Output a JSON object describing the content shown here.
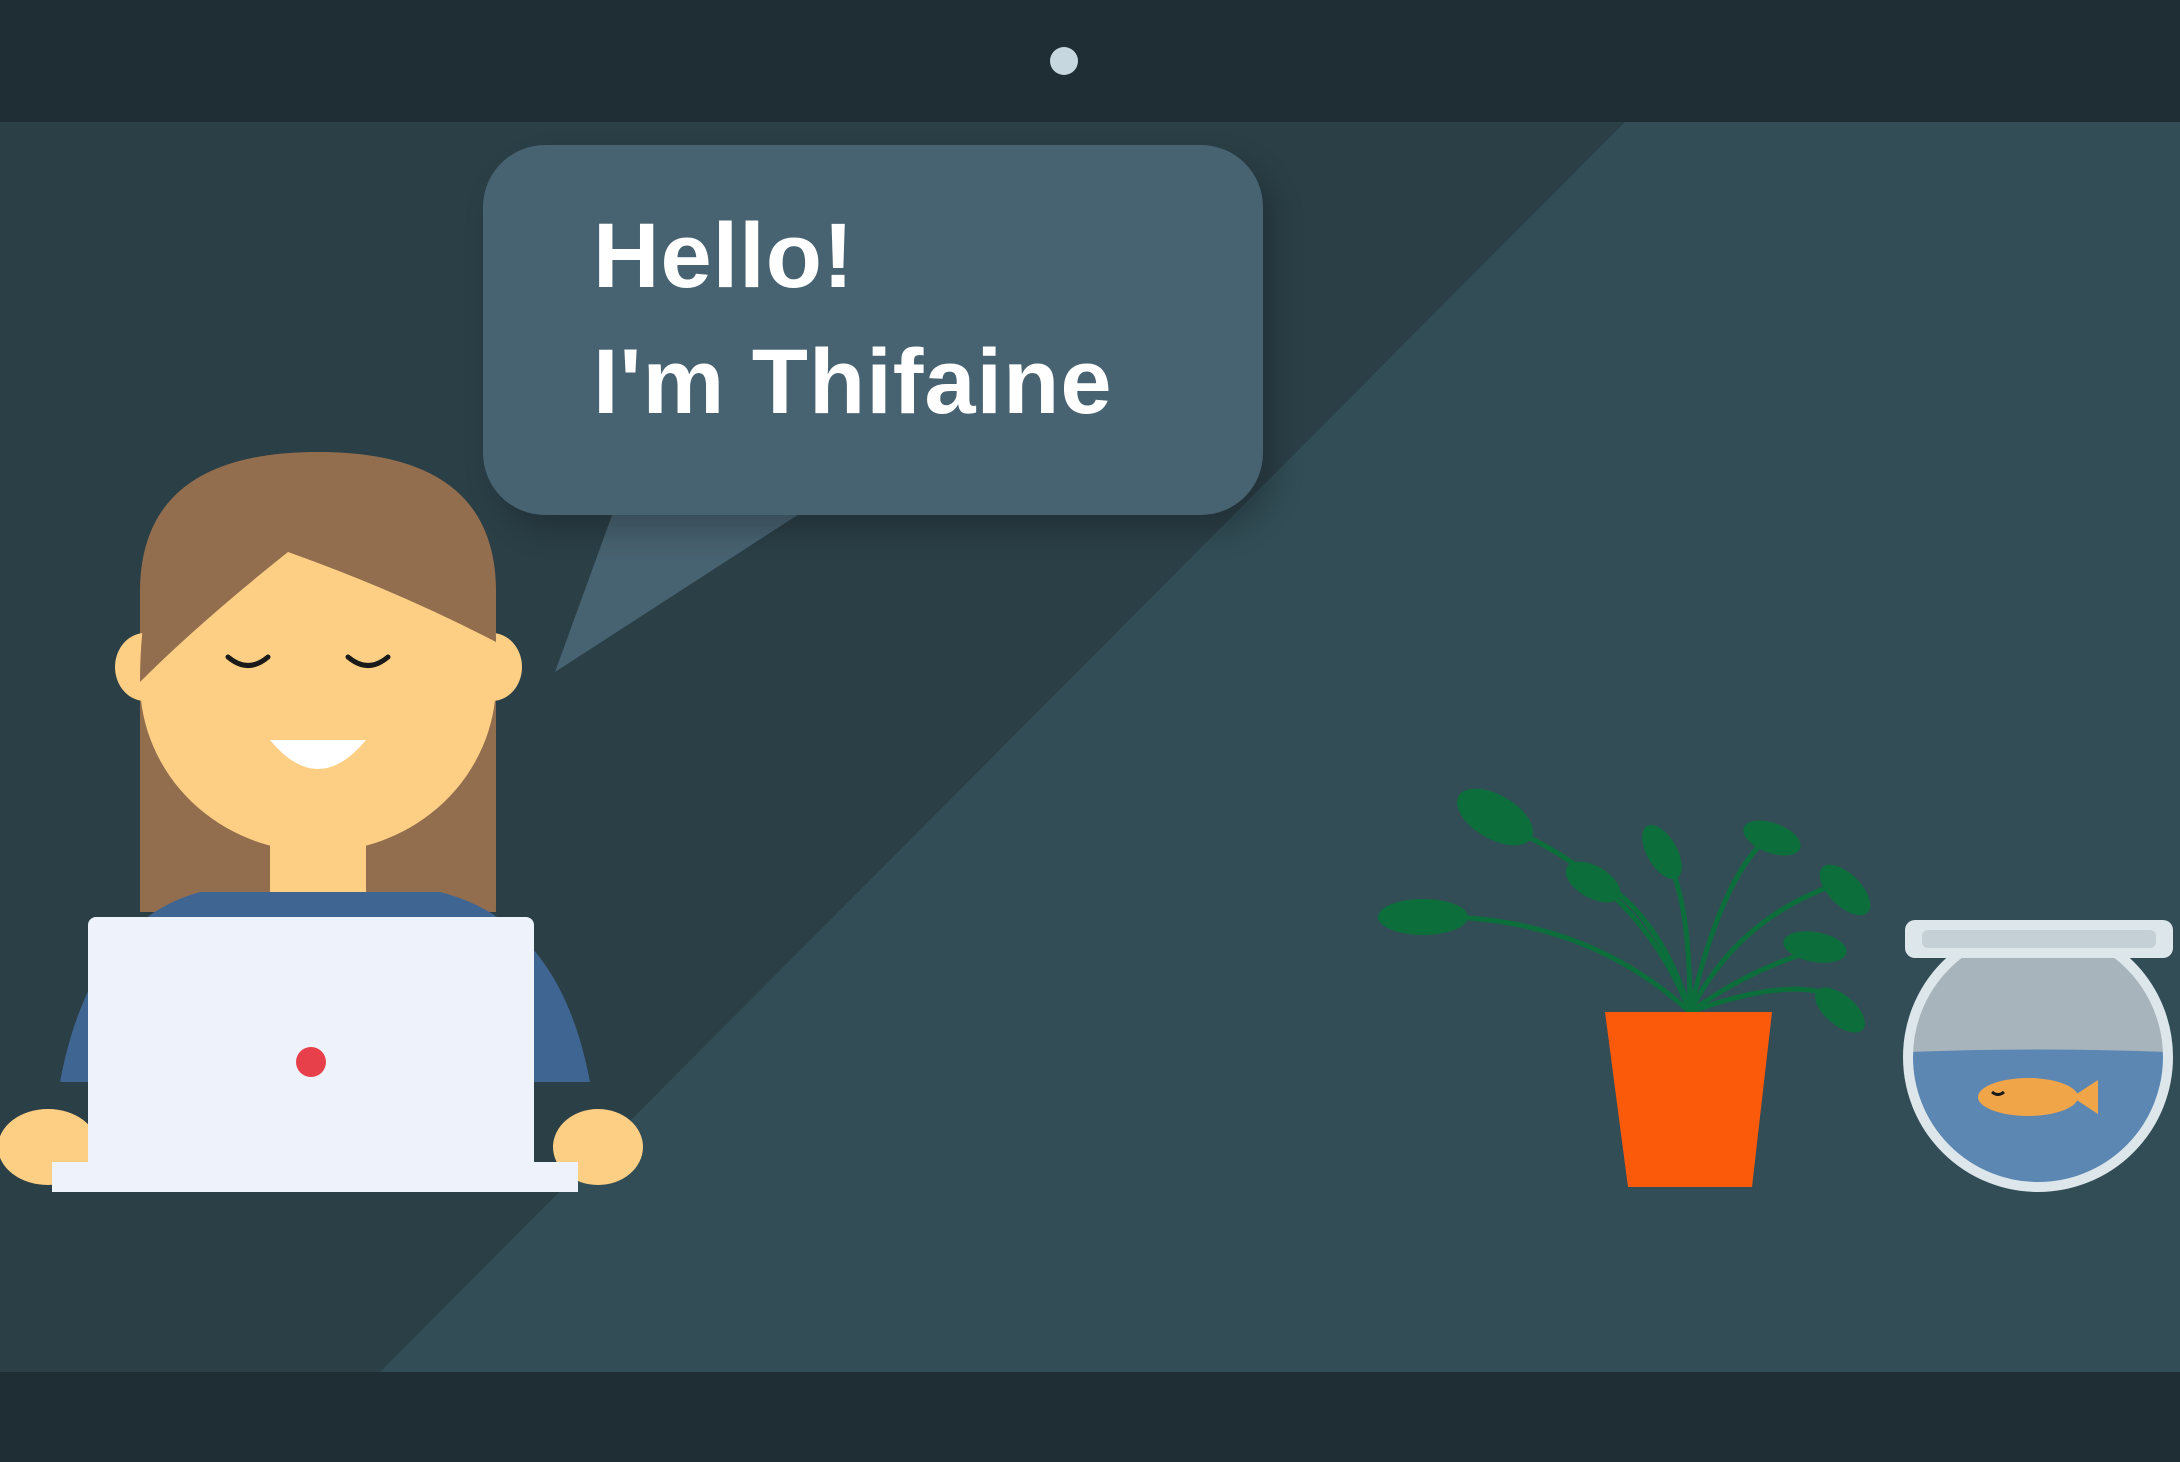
{
  "speech_bubble": {
    "line1": "Hello!",
    "line2": "I'm Thifaine"
  },
  "icons": {
    "webcam": "camera-dot",
    "character": "person-with-laptop",
    "plant": "potted-plant",
    "fishbowl": "fishbowl-with-goldfish"
  },
  "colors": {
    "frame": "#1f2d34",
    "screen_dark": "#2b3f47",
    "screen_light": "#324d56",
    "bubble": "#476270",
    "skin": "#fdcf85",
    "hair": "#936e4e",
    "laptop": "#eef3fb",
    "laptop_logo": "#e8404a",
    "shirt": "#3f6692",
    "pot": "#fc5a0b",
    "leaf": "#0c6e3b",
    "water": "#5b87b2",
    "fish": "#f0a549"
  }
}
